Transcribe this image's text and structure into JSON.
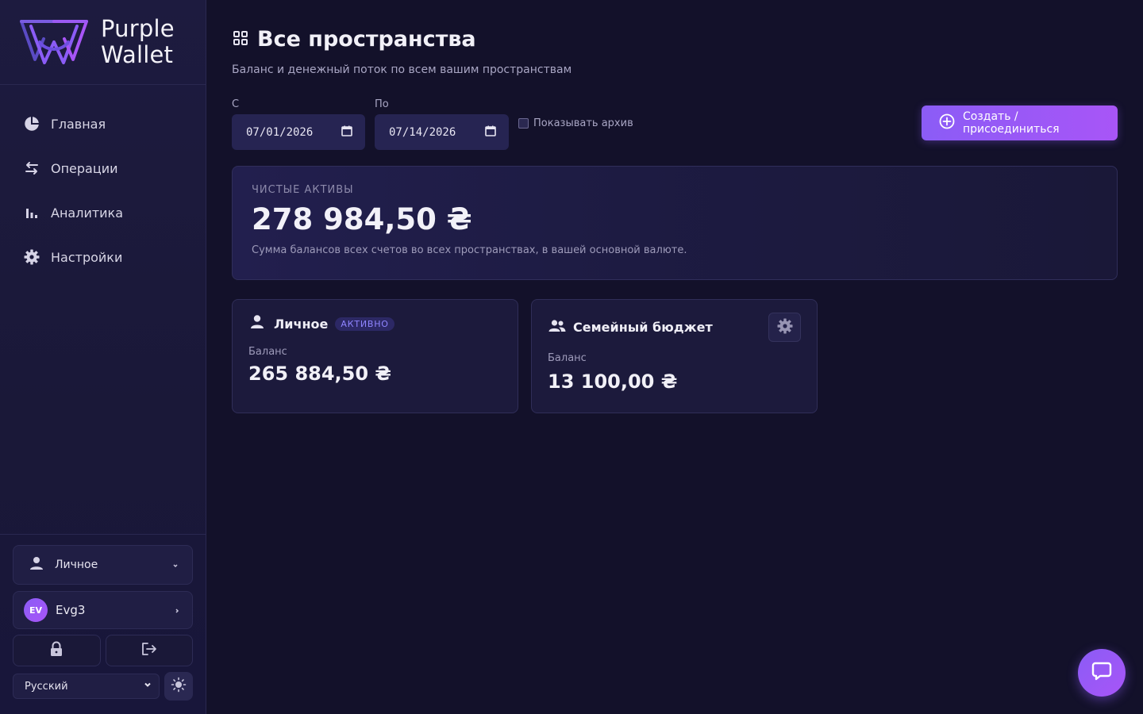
{
  "app": {
    "brand_line1": "Purple",
    "brand_line2": "Wallet"
  },
  "sidebar": {
    "nav": [
      {
        "label": "Главная",
        "icon": "pie-chart-icon"
      },
      {
        "label": "Операции",
        "icon": "arrows-swap-icon"
      },
      {
        "label": "Аналитика",
        "icon": "bar-chart-icon"
      },
      {
        "label": "Настройки",
        "icon": "gear-icon"
      }
    ],
    "space_selector": {
      "value": "Личное"
    },
    "user": {
      "initials": "EV",
      "name": "Evg3"
    },
    "language": {
      "value": "Русский"
    }
  },
  "header": {
    "title": "Все пространства",
    "subtitle": "Баланс и денежный поток по всем вашим пространствам"
  },
  "filters": {
    "from_label": "С",
    "from_value": "07/01/2026",
    "to_label": "По",
    "to_value": "07/14/2026",
    "archive_label": "Показывать архив",
    "archive_checked": false
  },
  "create_button": {
    "label": "Создать / присоединиться"
  },
  "net_assets": {
    "label": "ЧИСТЫЕ АКТИВЫ",
    "value": "278 984,50 ₴",
    "description": "Сумма балансов всех счетов во всех пространствах, в вашей основной валюте."
  },
  "spaces": [
    {
      "name": "Личное",
      "badge": "АКТИВНО",
      "balance_label": "Баланс",
      "balance": "265 884,50 ₴"
    },
    {
      "name": "Семейный бюджет",
      "balance_label": "Баланс",
      "balance": "13 100,00 ₴"
    }
  ],
  "colors": {
    "background": "#13112a",
    "sidebar": "#1d1b3f",
    "accent": "#8b5cf6",
    "accent_end": "#a855f7",
    "badge_text": "#8f84ff"
  }
}
